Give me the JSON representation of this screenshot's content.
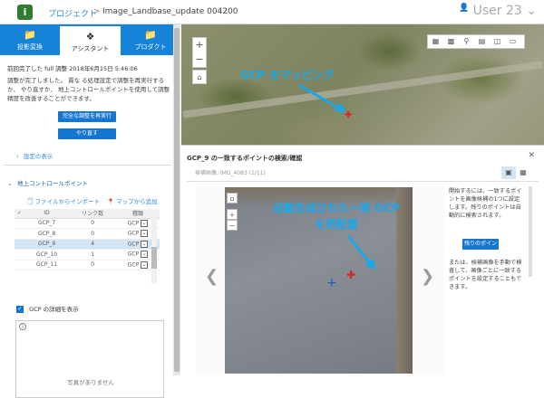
{
  "topbar": {
    "logo_glyph": "i",
    "breadcrumb_project": "プロジェクト",
    "breadcrumb_sep": ">",
    "breadcrumb_current": "Image_Landbase_update 004200",
    "user": "User 23"
  },
  "tabs": [
    {
      "label": "投影変換",
      "icon": "folder-icon",
      "active": false
    },
    {
      "label": "アシスタント",
      "icon": "assistant-icon",
      "active": true
    },
    {
      "label": "プロダクト",
      "icon": "folder-icon",
      "active": false
    }
  ],
  "assistant": {
    "status_time": "前回完了した full 調整 2018年6月15日 5:46:06",
    "status_msg": "調整が完了しました。 貫な る処理設定で調整を再実行するか、 やり直すか、 地上コントロールポイントを使用して調整精度を改善することができます。",
    "rerun_button": "完全な調整を再実行",
    "redo_button": "やり直す",
    "settings_link": "設定の表示"
  },
  "gcp": {
    "heading": "地上コントロールポイント",
    "import_link": "ファイルからインポート",
    "map_add_link": "マップから追加",
    "columns": [
      "✓",
      "ID",
      "リンク数",
      "種類"
    ],
    "rows": [
      {
        "id": "GCP_7",
        "links": "0",
        "type": "GCP",
        "selected": false
      },
      {
        "id": "GCP_8",
        "links": "0",
        "type": "GCP",
        "selected": false
      },
      {
        "id": "GCP_9",
        "links": "4",
        "type": "GCP",
        "selected": true
      },
      {
        "id": "GCP_10",
        "links": "1",
        "type": "GCP",
        "selected": false
      },
      {
        "id": "GCP_11",
        "links": "0",
        "type": "GCP",
        "selected": false
      }
    ],
    "show_detail": "GCP の詳細を表示",
    "no_photo": "写真がありません"
  },
  "map": {
    "annotation": "GCP をマッピング",
    "zoom_in": "+",
    "zoom_out": "−"
  },
  "dialog": {
    "title": "GCP_9 の一致するポイントの検索/確認",
    "subtitle_label": "候補画像:",
    "subtitle_value": "IMG_4083 (2/11)",
    "annotation": "自動生成された一致 GCP を再配置",
    "desc1": "開始するには、一致するポイントを画像候補の1つに設定します。残りのポイントは自動的に検索されます。",
    "button": "残りのポイントを検索",
    "desc2": "または、候補画像を手動で検査して、画像ごとに一致するポイントを設定することもできます。"
  },
  "colors": {
    "accent": "#1683d8",
    "annotation": "#19a8ea",
    "marker_red": "#dd2222"
  }
}
